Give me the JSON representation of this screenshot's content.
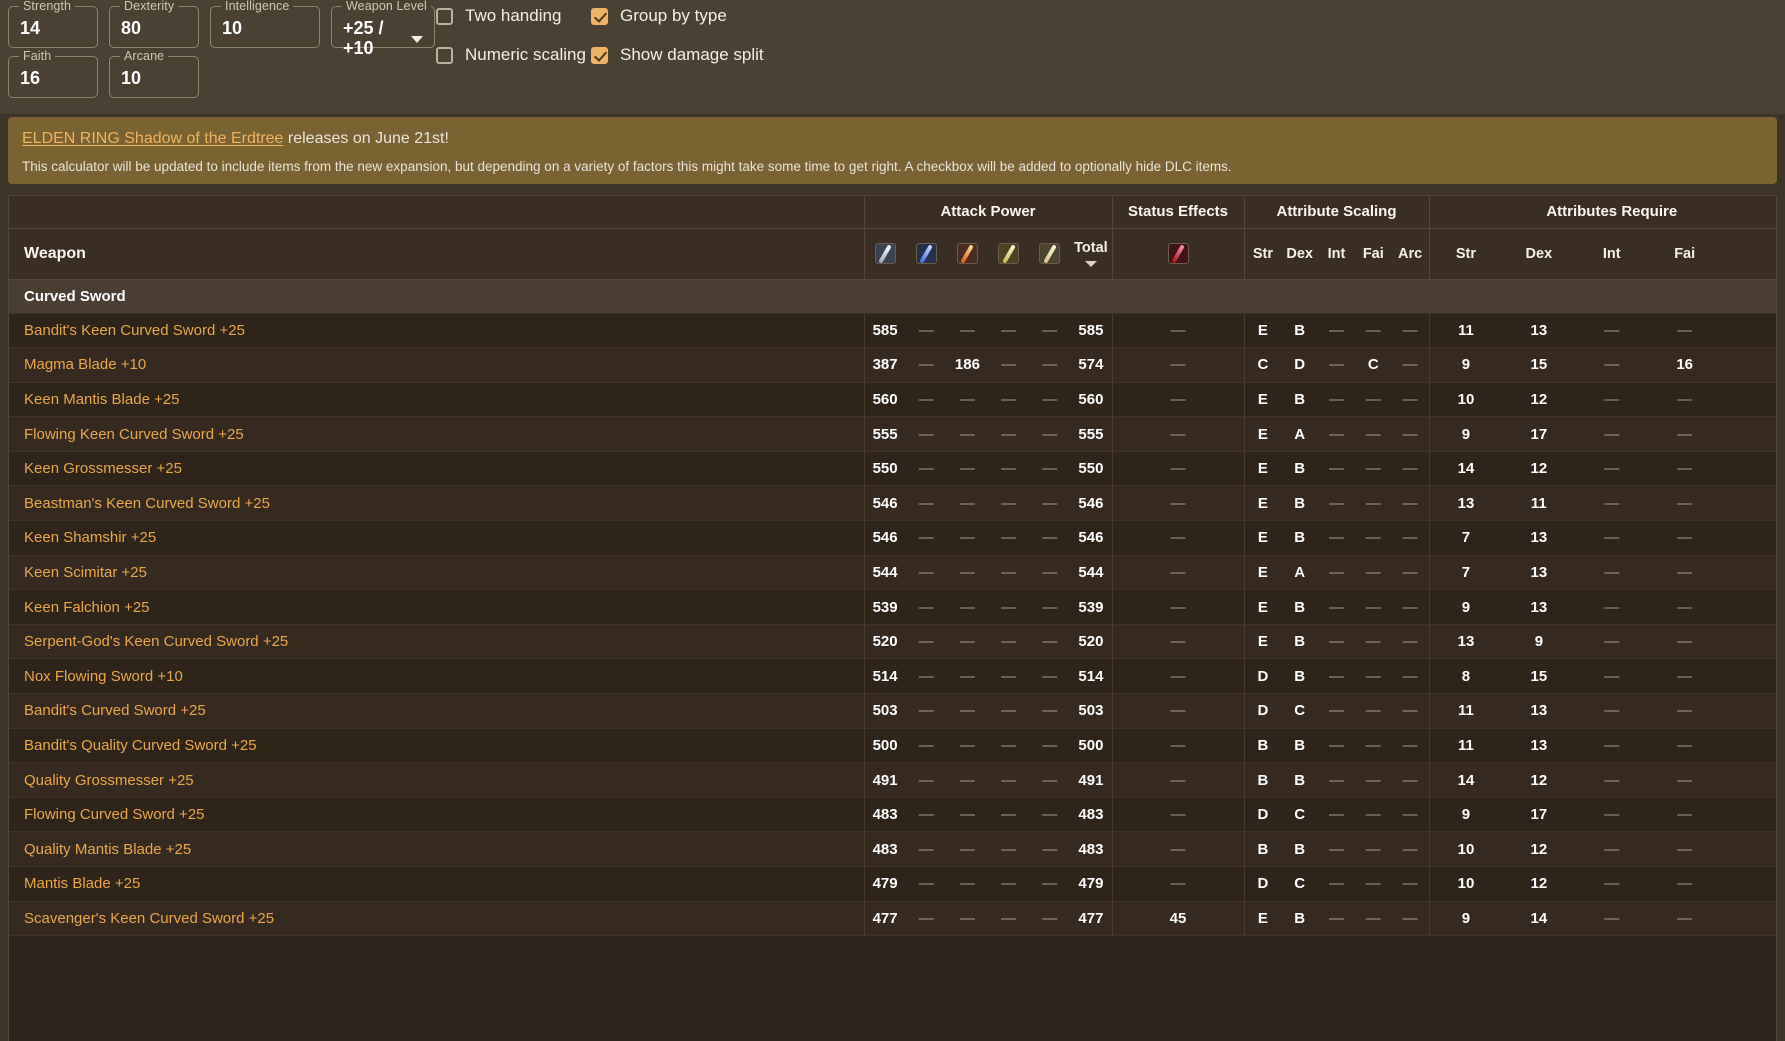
{
  "stats": {
    "row1": [
      {
        "label": "Strength",
        "value": "14",
        "name": "strength"
      },
      {
        "label": "Dexterity",
        "value": "80",
        "name": "dexterity"
      },
      {
        "label": "Intelligence",
        "value": "10",
        "name": "intelligence"
      }
    ],
    "row2": [
      {
        "label": "Faith",
        "value": "16",
        "name": "faith"
      },
      {
        "label": "Arcane",
        "value": "10",
        "name": "arcane"
      }
    ],
    "weapon_level": {
      "label": "Weapon Level",
      "value": "+25 / +10"
    }
  },
  "options": [
    {
      "label": "Two handing",
      "checked": false,
      "name": "two-handing"
    },
    {
      "label": "Group by type",
      "checked": true,
      "name": "group-by-type"
    },
    {
      "label": "Numeric scaling",
      "checked": false,
      "name": "numeric-scaling"
    },
    {
      "label": "Show damage split",
      "checked": true,
      "name": "show-damage-split"
    }
  ],
  "banner": {
    "link_text": "ELDEN RING Shadow of the Erdtree",
    "headline_rest": " releases on June 21st!",
    "body": "This calculator will be updated to include items from the new expansion, but depending on a variety of factors this might take some time to get right. A checkbox will be added to optionally hide DLC items."
  },
  "table": {
    "group_headers": {
      "weapon": "Weapon",
      "attack_power": "Attack Power",
      "status_effects": "Status Effects",
      "attribute_scaling": "Attribute Scaling",
      "attributes_required": "Attributes Require"
    },
    "attack_icons": [
      "physical-damage-icon",
      "magic-damage-icon",
      "fire-damage-icon",
      "lightning-damage-icon",
      "holy-damage-icon"
    ],
    "total_label": "Total",
    "status_icons": [
      "bleed-status-icon"
    ],
    "scaling_cols": [
      "Str",
      "Dex",
      "Int",
      "Fai",
      "Arc"
    ],
    "required_cols": [
      "Str",
      "Dex",
      "Int",
      "Fai"
    ],
    "group_row_label": "Curved Sword",
    "rows": [
      {
        "name": "Bandit's Keen Curved Sword +25",
        "atk": [
          "585",
          "—",
          "—",
          "—",
          "—"
        ],
        "total": "585",
        "status": [
          "—"
        ],
        "scaling": [
          "E",
          "B",
          "—",
          "—",
          "—"
        ],
        "required": [
          "11",
          "13",
          "—",
          "—"
        ]
      },
      {
        "name": "Magma Blade +10",
        "atk": [
          "387",
          "—",
          "186",
          "—",
          "—"
        ],
        "total": "574",
        "status": [
          "—"
        ],
        "scaling": [
          "C",
          "D",
          "—",
          "C",
          "—"
        ],
        "required": [
          "9",
          "15",
          "—",
          "16"
        ]
      },
      {
        "name": "Keen Mantis Blade +25",
        "atk": [
          "560",
          "—",
          "—",
          "—",
          "—"
        ],
        "total": "560",
        "status": [
          "—"
        ],
        "scaling": [
          "E",
          "B",
          "—",
          "—",
          "—"
        ],
        "required": [
          "10",
          "12",
          "—",
          "—"
        ]
      },
      {
        "name": "Flowing Keen Curved Sword +25",
        "atk": [
          "555",
          "—",
          "—",
          "—",
          "—"
        ],
        "total": "555",
        "status": [
          "—"
        ],
        "scaling": [
          "E",
          "A",
          "—",
          "—",
          "—"
        ],
        "required": [
          "9",
          "17",
          "—",
          "—"
        ]
      },
      {
        "name": "Keen Grossmesser +25",
        "atk": [
          "550",
          "—",
          "—",
          "—",
          "—"
        ],
        "total": "550",
        "status": [
          "—"
        ],
        "scaling": [
          "E",
          "B",
          "—",
          "—",
          "—"
        ],
        "required": [
          "14",
          "12",
          "—",
          "—"
        ]
      },
      {
        "name": "Beastman's Keen Curved Sword +25",
        "atk": [
          "546",
          "—",
          "—",
          "—",
          "—"
        ],
        "total": "546",
        "status": [
          "—"
        ],
        "scaling": [
          "E",
          "B",
          "—",
          "—",
          "—"
        ],
        "required": [
          "13",
          "11",
          "—",
          "—"
        ]
      },
      {
        "name": "Keen Shamshir +25",
        "atk": [
          "546",
          "—",
          "—",
          "—",
          "—"
        ],
        "total": "546",
        "status": [
          "—"
        ],
        "scaling": [
          "E",
          "B",
          "—",
          "—",
          "—"
        ],
        "required": [
          "7",
          "13",
          "—",
          "—"
        ]
      },
      {
        "name": "Keen Scimitar +25",
        "atk": [
          "544",
          "—",
          "—",
          "—",
          "—"
        ],
        "total": "544",
        "status": [
          "—"
        ],
        "scaling": [
          "E",
          "A",
          "—",
          "—",
          "—"
        ],
        "required": [
          "7",
          "13",
          "—",
          "—"
        ]
      },
      {
        "name": "Keen Falchion +25",
        "atk": [
          "539",
          "—",
          "—",
          "—",
          "—"
        ],
        "total": "539",
        "status": [
          "—"
        ],
        "scaling": [
          "E",
          "B",
          "—",
          "—",
          "—"
        ],
        "required": [
          "9",
          "13",
          "—",
          "—"
        ]
      },
      {
        "name": "Serpent-God's Keen Curved Sword +25",
        "atk": [
          "520",
          "—",
          "—",
          "—",
          "—"
        ],
        "total": "520",
        "status": [
          "—"
        ],
        "scaling": [
          "E",
          "B",
          "—",
          "—",
          "—"
        ],
        "required": [
          "13",
          "9",
          "—",
          "—"
        ]
      },
      {
        "name": "Nox Flowing Sword +10",
        "atk": [
          "514",
          "—",
          "—",
          "—",
          "—"
        ],
        "total": "514",
        "status": [
          "—"
        ],
        "scaling": [
          "D",
          "B",
          "—",
          "—",
          "—"
        ],
        "required": [
          "8",
          "15",
          "—",
          "—"
        ]
      },
      {
        "name": "Bandit's Curved Sword +25",
        "atk": [
          "503",
          "—",
          "—",
          "—",
          "—"
        ],
        "total": "503",
        "status": [
          "—"
        ],
        "scaling": [
          "D",
          "C",
          "—",
          "—",
          "—"
        ],
        "required": [
          "11",
          "13",
          "—",
          "—"
        ]
      },
      {
        "name": "Bandit's Quality Curved Sword +25",
        "atk": [
          "500",
          "—",
          "—",
          "—",
          "—"
        ],
        "total": "500",
        "status": [
          "—"
        ],
        "scaling": [
          "B",
          "B",
          "—",
          "—",
          "—"
        ],
        "required": [
          "11",
          "13",
          "—",
          "—"
        ]
      },
      {
        "name": "Quality Grossmesser +25",
        "atk": [
          "491",
          "—",
          "—",
          "—",
          "—"
        ],
        "total": "491",
        "status": [
          "—"
        ],
        "scaling": [
          "B",
          "B",
          "—",
          "—",
          "—"
        ],
        "required": [
          "14",
          "12",
          "—",
          "—"
        ]
      },
      {
        "name": "Flowing Curved Sword +25",
        "atk": [
          "483",
          "—",
          "—",
          "—",
          "—"
        ],
        "total": "483",
        "status": [
          "—"
        ],
        "scaling": [
          "D",
          "C",
          "—",
          "—",
          "—"
        ],
        "required": [
          "9",
          "17",
          "—",
          "—"
        ]
      },
      {
        "name": "Quality Mantis Blade +25",
        "atk": [
          "483",
          "—",
          "—",
          "—",
          "—"
        ],
        "total": "483",
        "status": [
          "—"
        ],
        "scaling": [
          "B",
          "B",
          "—",
          "—",
          "—"
        ],
        "required": [
          "10",
          "12",
          "—",
          "—"
        ]
      },
      {
        "name": "Mantis Blade +25",
        "atk": [
          "479",
          "—",
          "—",
          "—",
          "—"
        ],
        "total": "479",
        "status": [
          "—"
        ],
        "scaling": [
          "D",
          "C",
          "—",
          "—",
          "—"
        ],
        "required": [
          "10",
          "12",
          "—",
          "—"
        ]
      },
      {
        "name": "Scavenger's Keen Curved Sword +25",
        "atk": [
          "477",
          "—",
          "—",
          "—",
          "—"
        ],
        "total": "477",
        "status": [
          "45"
        ],
        "scaling": [
          "E",
          "B",
          "—",
          "—",
          "—"
        ],
        "required": [
          "9",
          "14",
          "—",
          "—"
        ]
      }
    ]
  },
  "colors": {
    "accent": "#eaa64a",
    "banner_bg": "#7a6233",
    "checkbox_on": "#f0b263",
    "page_bg": "#3d3527"
  }
}
